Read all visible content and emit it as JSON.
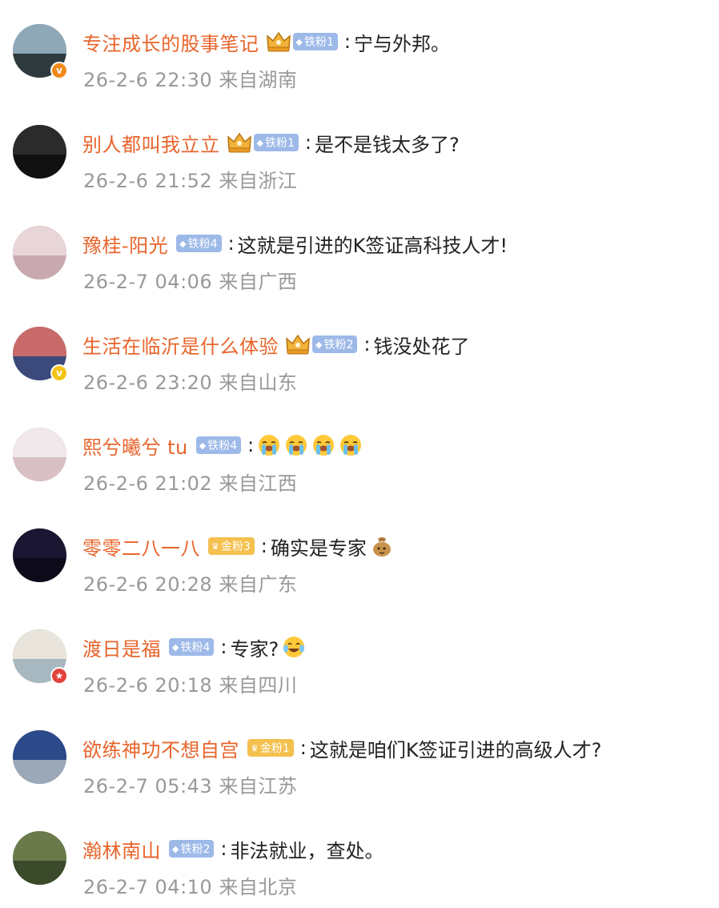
{
  "comments": [
    {
      "nick": "专注成长的股事笔记",
      "fan": "铁粉1",
      "fan_type": "iron",
      "crown": true,
      "text": "宁与外邦。",
      "emojis": [],
      "date": "26-2-6 22:30",
      "loc": "来自湖南",
      "badge": "v",
      "badge_color": "#F28A1A",
      "avatar_colors": [
        "#8fa8b8",
        "#2f3a3f"
      ]
    },
    {
      "nick": "别人都叫我立立",
      "fan": "铁粉1",
      "fan_type": "iron",
      "crown": true,
      "text": "是不是钱太多了?",
      "emojis": [],
      "date": "26-2-6 21:52",
      "loc": "来自浙江",
      "badge": "",
      "badge_color": "",
      "avatar_colors": [
        "#2b2b2b",
        "#111111"
      ]
    },
    {
      "nick": "豫桂-阳光",
      "fan": "铁粉4",
      "fan_type": "iron",
      "crown": false,
      "text": "这就是引进的K签证高科技人才!",
      "emojis": [],
      "date": "26-2-7 04:06",
      "loc": "来自广西",
      "badge": "",
      "badge_color": "",
      "avatar_colors": [
        "#e8d5d8",
        "#c9a9b0"
      ]
    },
    {
      "nick": "生活在临沂是什么体验",
      "fan": "铁粉2",
      "fan_type": "iron",
      "crown": true,
      "text": "钱没处花了",
      "emojis": [],
      "date": "26-2-6 23:20",
      "loc": "来自山东",
      "badge": "v",
      "badge_color": "#F2C318",
      "avatar_colors": [
        "#c96a6a",
        "#3b4a7a"
      ]
    },
    {
      "nick": "熙兮曦兮 tu",
      "fan": "铁粉4",
      "fan_type": "iron",
      "crown": false,
      "text": "",
      "emojis": [
        "crying-face",
        "crying-face",
        "crying-face",
        "crying-face"
      ],
      "date": "26-2-6 21:02",
      "loc": "来自江西",
      "badge": "",
      "badge_color": "",
      "avatar_colors": [
        "#f0e8ea",
        "#d8c0c5"
      ]
    },
    {
      "nick": "零零二八一八",
      "fan": "金粉3",
      "fan_type": "gold",
      "crown": false,
      "text": "确实是专家",
      "emojis": [
        "money-bag"
      ],
      "date": "26-2-6 20:28",
      "loc": "来自广东",
      "badge": "",
      "badge_color": "",
      "avatar_colors": [
        "#1a1530",
        "#0d0b1a"
      ]
    },
    {
      "nick": "渡日是福",
      "fan": "铁粉4",
      "fan_type": "iron",
      "crown": false,
      "text": "专家?",
      "emojis": [
        "laughing-tears"
      ],
      "date": "26-2-6 20:18",
      "loc": "来自四川",
      "badge": "★",
      "badge_color": "#E3423B",
      "avatar_colors": [
        "#e9e4dc",
        "#a8b8c0"
      ]
    },
    {
      "nick": "欲练神功不想自宫",
      "fan": "金粉1",
      "fan_type": "gold",
      "crown": false,
      "text": "这就是咱们K签证引进的高级人才?",
      "emojis": [],
      "date": "26-2-7 05:43",
      "loc": "来自江苏",
      "badge": "",
      "badge_color": "",
      "avatar_colors": [
        "#2c4a8a",
        "#9aa8b8"
      ]
    },
    {
      "nick": "瀚林南山",
      "fan": "铁粉2",
      "fan_type": "iron",
      "crown": false,
      "text": "非法就业，查处。",
      "emojis": [],
      "date": "26-2-7 04:10",
      "loc": "来自北京",
      "badge": "",
      "badge_color": "",
      "avatar_colors": [
        "#6a7a4a",
        "#3a4a2a"
      ]
    }
  ],
  "colors": {
    "nick": "#E8642B",
    "meta": "#999999",
    "text": "#222222",
    "iron_badge": "#9DB9E8",
    "gold_badge": "#F4C04E"
  }
}
